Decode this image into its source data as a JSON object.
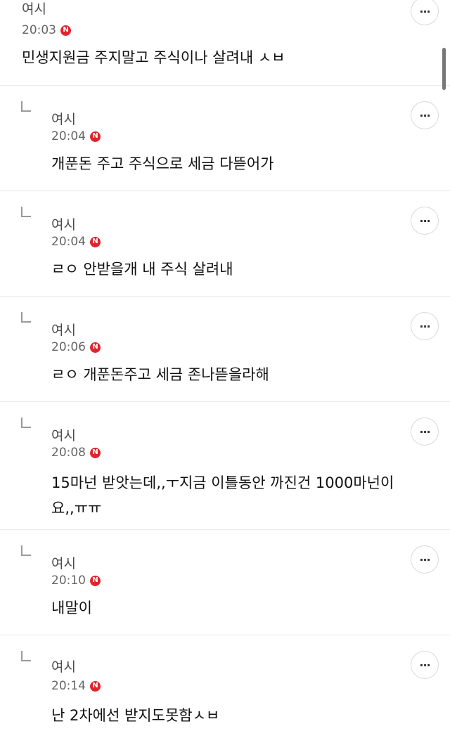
{
  "comments": [
    {
      "author": "여시",
      "time": "20:03",
      "badge": "N",
      "text": "민생지원금 주지말고 주식이나 살려내 ㅅㅂ",
      "reply": false
    },
    {
      "author": "여시",
      "time": "20:04",
      "badge": "N",
      "text": "개푼돈 주고 주식으로 세금 다뜯어가",
      "reply": true
    },
    {
      "author": "여시",
      "time": "20:04",
      "badge": "N",
      "text": "ㄹㅇ 안받을개 내 주식 살려내",
      "reply": true
    },
    {
      "author": "여시",
      "time": "20:06",
      "badge": "N",
      "text": "ㄹㅇ 개푼돈주고 세금 존나뜯을라해",
      "reply": true
    },
    {
      "author": "여시",
      "time": "20:08",
      "badge": "N",
      "text": "15마넌 받앗는데,,ㅜ지금 이틀동안 까진건 1000마넌이\n요,,ㅠㅠ",
      "reply": true
    },
    {
      "author": "여시",
      "time": "20:10",
      "badge": "N",
      "text": "내말이",
      "reply": true
    },
    {
      "author": "여시",
      "time": "20:14",
      "badge": "N",
      "text": "난 2차에선 받지도못함ㅅㅂ",
      "reply": true
    }
  ],
  "more_label": "···"
}
